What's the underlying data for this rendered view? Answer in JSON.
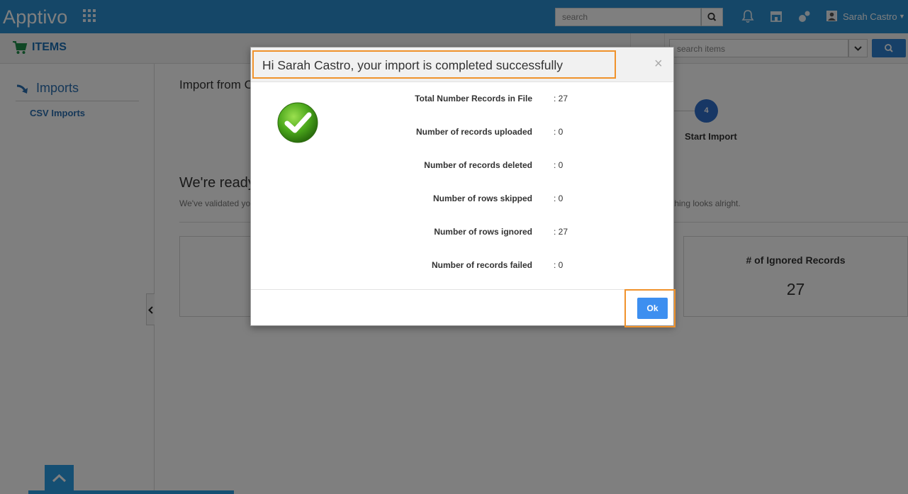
{
  "app": {
    "logo": "Apptivo"
  },
  "header": {
    "search": {
      "placeholder": "search"
    },
    "user": {
      "name": "Sarah Castro"
    }
  },
  "subbar": {
    "module_title": "ITEMS",
    "items_search": {
      "placeholder": "search items"
    }
  },
  "sidebar": {
    "heading": "Imports",
    "items": [
      {
        "label": "CSV Imports"
      }
    ]
  },
  "main": {
    "import_title": "Import from C",
    "step": {
      "number": "4",
      "label": "Start Import"
    },
    "ready_title": "We're ready",
    "validated_text_start": "We've validated yo",
    "validated_text_end": "ything looks alright.",
    "ignored_card": {
      "label": "# of Ignored Records",
      "value": "27"
    }
  },
  "modal": {
    "title": "Hi Sarah Castro, your import is completed successfully",
    "close": "×",
    "stats": [
      {
        "label": "Total Number Records in File",
        "value": ": 27"
      },
      {
        "label": "Number of records uploaded",
        "value": ": 0"
      },
      {
        "label": "Number of records deleted",
        "value": ": 0"
      },
      {
        "label": "Number of rows skipped",
        "value": ": 0"
      },
      {
        "label": "Number of rows ignored",
        "value": ": 27"
      },
      {
        "label": "Number of records failed",
        "value": ": 0"
      }
    ],
    "ok_label": "Ok"
  },
  "colors": {
    "topbar": "#2b8fd0",
    "accent": "#1a6fb5",
    "highlight": "#f0922b",
    "ok_button": "#3d8ff0"
  }
}
